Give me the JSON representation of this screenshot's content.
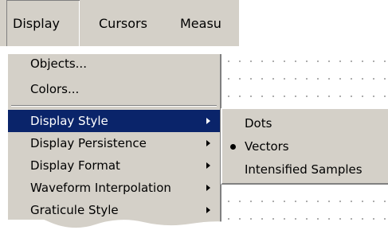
{
  "menubar": {
    "items": [
      {
        "label": "Display"
      },
      {
        "label": "Cursors"
      },
      {
        "label": "Measu"
      }
    ]
  },
  "display_menu": {
    "items": [
      {
        "label": "Objects..."
      },
      {
        "label": "Colors..."
      },
      {
        "label": "Display Style"
      },
      {
        "label": "Display Persistence"
      },
      {
        "label": "Display Format"
      },
      {
        "label": "Waveform Interpolation"
      },
      {
        "label": "Graticule Style"
      }
    ],
    "highlighted": "Display Style"
  },
  "display_style_submenu": {
    "items": [
      {
        "label": "Dots"
      },
      {
        "label": "Vectors"
      },
      {
        "label": "Intensified Samples"
      }
    ],
    "selected": "Vectors"
  },
  "colors": {
    "menu_background": "#d4d0c8",
    "highlight_background": "#0a246a",
    "highlight_text": "#ffffff"
  }
}
